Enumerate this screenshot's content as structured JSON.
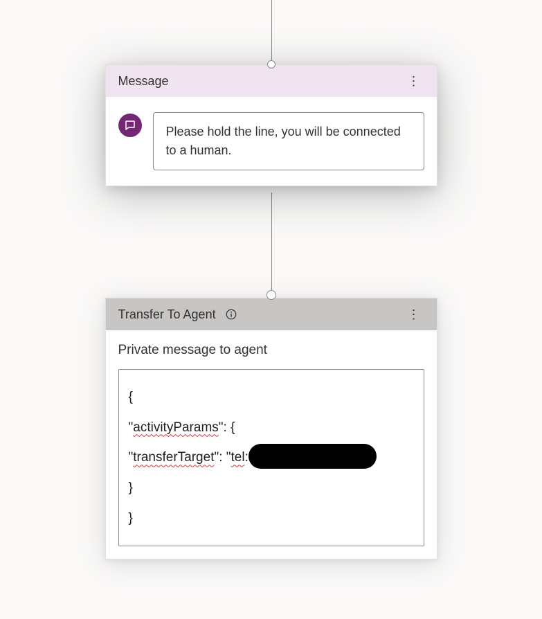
{
  "connectors": {
    "topHeight": 93,
    "midHeight": 152
  },
  "messageNode": {
    "title": "Message",
    "text": "Please hold the line, you will be connected to a human."
  },
  "transferNode": {
    "title": "Transfer To Agent",
    "fieldLabel": "Private message to agent",
    "json": {
      "linePrefix": "{",
      "activityKey": "activityParams",
      "transferKey": "transferTarget",
      "telPrefix": "tel",
      "redacted": true,
      "close1": "}",
      "close2": "}"
    }
  },
  "icons": {
    "more": "⋮"
  }
}
